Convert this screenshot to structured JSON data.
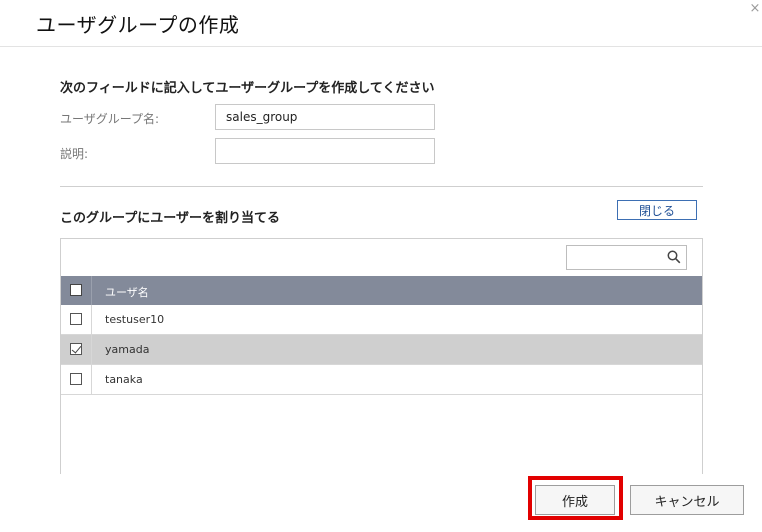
{
  "dialog": {
    "title": "ユーザグループの作成",
    "close_glyph": "×"
  },
  "form": {
    "instruction": "次のフィールドに記入してユーザーグループを作成してください",
    "group_name_label": "ユーザグループ名:",
    "group_name_value": "sales_group",
    "description_label": "説明:",
    "description_value": ""
  },
  "assign": {
    "heading": "このグループにユーザーを割り当てる",
    "close_button_label": "閉じる",
    "search_value": "",
    "column_header": "ユーザ名",
    "header_checked": false,
    "users": [
      {
        "name": "testuser10",
        "checked": false,
        "selected": false
      },
      {
        "name": "yamada",
        "checked": true,
        "selected": true
      },
      {
        "name": "tanaka",
        "checked": false,
        "selected": false
      }
    ]
  },
  "footer": {
    "create_label": "作成",
    "cancel_label": "キャンセル"
  },
  "colors": {
    "table_header_bg": "#838a9a",
    "selected_row_bg": "#cfcfcf",
    "highlight_border": "#e20000",
    "close_button_border": "#3d6fb3"
  }
}
